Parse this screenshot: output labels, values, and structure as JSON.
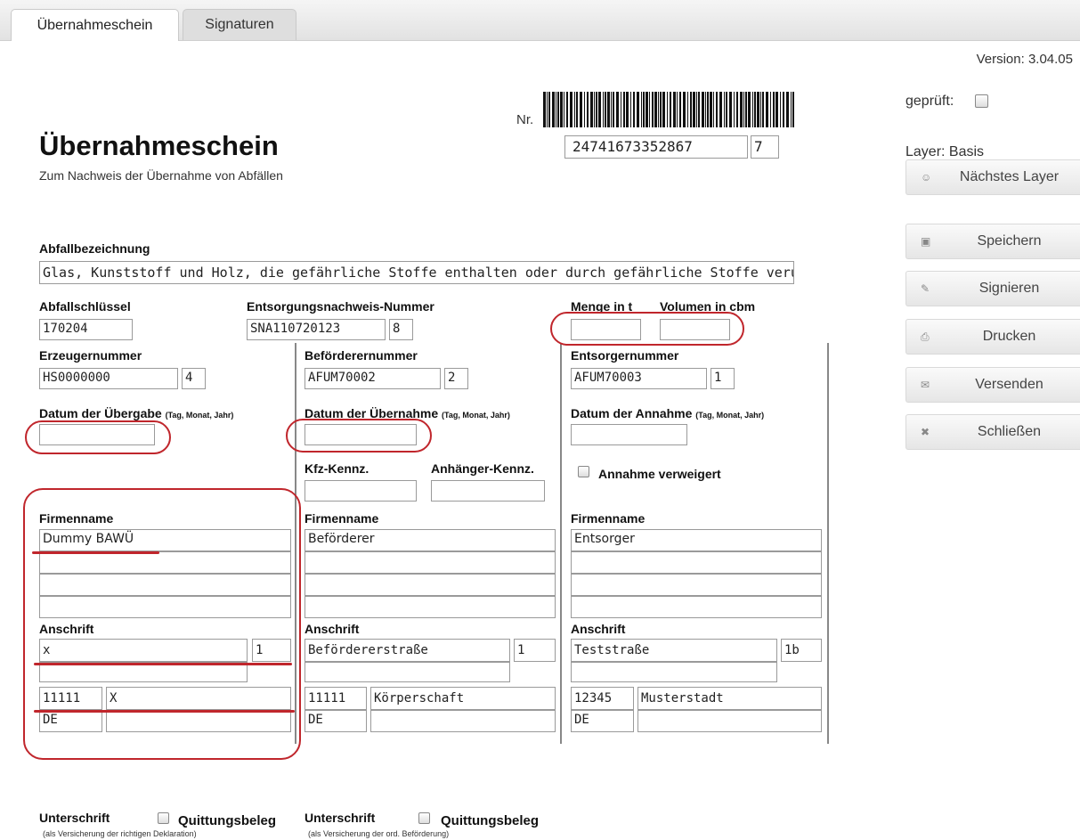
{
  "tabs": [
    {
      "label": "Übernahmeschein"
    },
    {
      "label": "Signaturen"
    }
  ],
  "version": "Version: 3.04.05",
  "geprueft_label": "geprüft:",
  "layer_label": "Layer: Basis",
  "buttons": {
    "next_layer": "Nächstes Layer",
    "save": "Speichern",
    "sign": "Signieren",
    "print": "Drucken",
    "send": "Versenden",
    "close": "Schließen"
  },
  "form": {
    "title": "Übernahmeschein",
    "subtitle": "Zum Nachweis der Übernahme von Abfällen",
    "nr_label": "Nr.",
    "nr_value": "24741673352867",
    "nr_check": "7",
    "abfallbezeichnung_label": "Abfallbezeichnung",
    "abfallbezeichnung_value": "Glas, Kunststoff und Holz, die gefährliche Stoffe enthalten oder durch gefährliche Stoffe verunreinigt si",
    "abfallschluessel_label": "Abfallschlüssel",
    "abfallschluessel_value": "170204",
    "entsorgungsnachweis_label": "Entsorgungsnachweis-Nummer",
    "entsorgungsnachweis_value": "SNA110720123",
    "entsorgungsnachweis_check": "8",
    "menge_label": "Menge in t",
    "volumen_label": "Volumen in cbm",
    "menge_value": "",
    "volumen_value": "",
    "erzeuger": {
      "nummer_label": "Erzeugernummer",
      "nummer_value": "HS0000000",
      "nummer_check": "4",
      "datum_label": "Datum der Übergabe",
      "datum_hint": "(Tag, Monat, Jahr)",
      "datum_value": "",
      "firmenname_label": "Firmenname",
      "firmenname_lines": [
        "Dummy BAWÜ",
        "",
        "",
        ""
      ],
      "anschrift_label": "Anschrift",
      "street": "x",
      "housenr": "1",
      "street2": "",
      "plz": "11111",
      "ort": "X",
      "country": "DE",
      "extra": ""
    },
    "befoerderer": {
      "nummer_label": "Beförderernummer",
      "nummer_value": "AFUM70002",
      "nummer_check": "2",
      "datum_label": "Datum der Übernahme",
      "datum_hint": "(Tag, Monat, Jahr)",
      "datum_value": "",
      "kfz_label": "Kfz-Kennz.",
      "anhaenger_label": "Anhänger-Kennz.",
      "firmenname_label": "Firmenname",
      "firmenname_lines": [
        "Beförderer",
        "",
        "",
        ""
      ],
      "anschrift_label": "Anschrift",
      "street": "Befördererstraße",
      "housenr": "1",
      "street2": "",
      "plz": "11111",
      "ort": "Körperschaft",
      "country": "DE",
      "extra": ""
    },
    "entsorger": {
      "nummer_label": "Entsorgernummer",
      "nummer_value": "AFUM70003",
      "nummer_check": "1",
      "datum_label": "Datum der Annahme",
      "datum_hint": "(Tag, Monat, Jahr)",
      "datum_value": "",
      "annahme_verweigert_label": "Annahme verweigert",
      "firmenname_label": "Firmenname",
      "firmenname_lines": [
        "Entsorger",
        "",
        "",
        ""
      ],
      "anschrift_label": "Anschrift",
      "street": "Teststraße",
      "housenr": "1b",
      "street2": "",
      "plz": "12345",
      "ort": "Musterstadt",
      "country": "DE",
      "extra": ""
    },
    "signature1_label": "Unterschrift",
    "signature1_hint": "(als Versicherung der richtigen Deklaration)",
    "quittung1_label": "Quittungsbeleg",
    "signature2_label": "Unterschrift",
    "signature2_hint": "(als Versicherung der ord. Beförderung)",
    "quittung2_label": "Quittungsbeleg"
  }
}
